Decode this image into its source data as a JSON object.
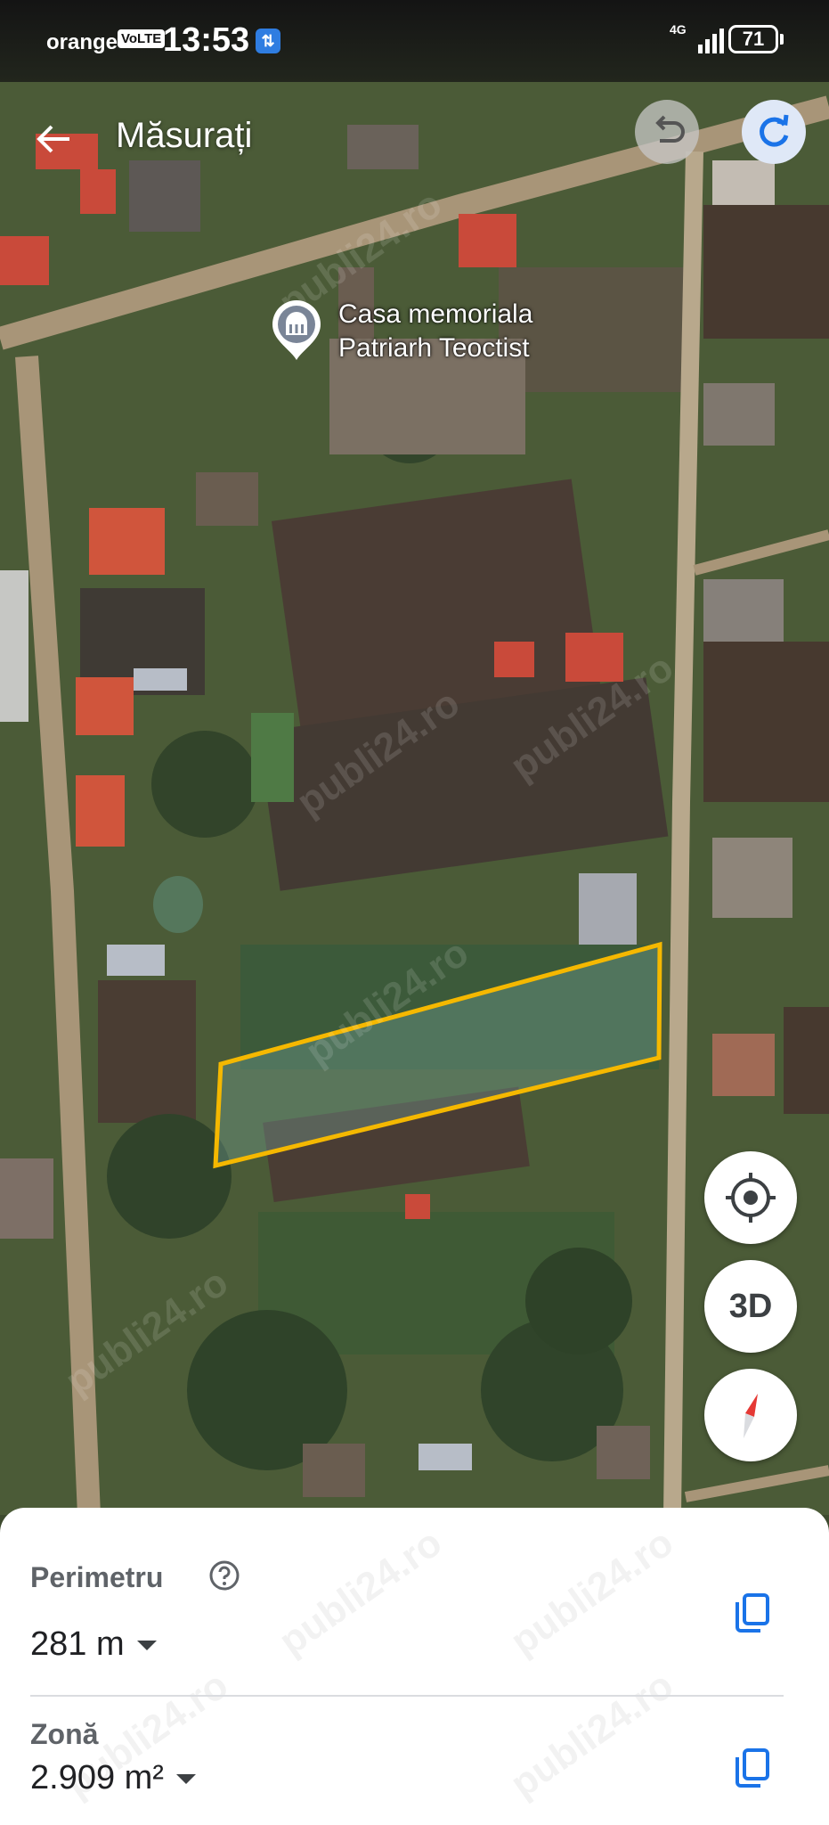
{
  "status_bar": {
    "carrier": "orange",
    "volte": "VoLTE",
    "time": "13:53",
    "network": "4G",
    "battery": "71"
  },
  "header": {
    "title": "Măsurați",
    "back_icon": "arrow-back-icon",
    "undo_icon": "undo-icon",
    "redo_icon": "redo-icon"
  },
  "map": {
    "place_label_line1": "Casa memoriala",
    "place_label_line2": "Patriarh Teoctist",
    "place_icon": "monument-pin-icon",
    "polygon_color": "#f5b800",
    "watermark": "publi24.ro"
  },
  "controls": {
    "location_icon": "my-location-icon",
    "view_3d": "3D",
    "compass_icon": "compass-icon"
  },
  "measure": {
    "perimeter_label": "Perimetru",
    "perimeter_value": "281 m",
    "area_label": "Zonă",
    "area_value": "2.909 m²",
    "accent_color": "#1a73e8"
  }
}
